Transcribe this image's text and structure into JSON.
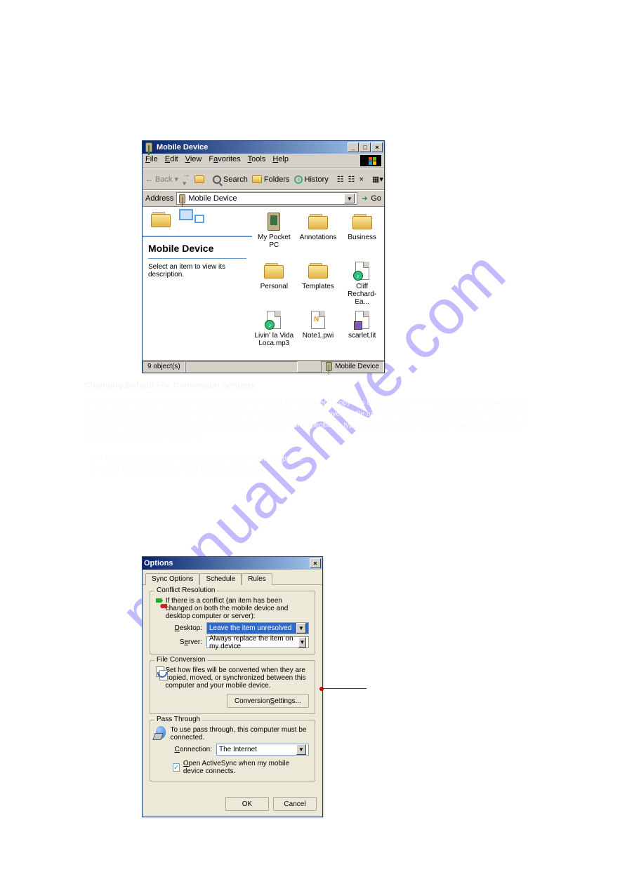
{
  "watermark": "manualshive.com",
  "explorer": {
    "title": "Mobile Device",
    "menus": [
      {
        "u": "F",
        "r": "ile"
      },
      {
        "u": "E",
        "r": "dit"
      },
      {
        "u": "V",
        "r": "iew"
      },
      {
        "l": "F",
        "u": "a",
        "r": "vorites"
      },
      {
        "u": "T",
        "r": "ools"
      },
      {
        "u": "H",
        "r": "elp"
      }
    ],
    "toolbar": {
      "back": "Back",
      "search": "Search",
      "folders": "Folders",
      "history": "History"
    },
    "address_label": "Address",
    "address_value": "Mobile Device",
    "go": "Go",
    "side": {
      "heading": "Mobile Device",
      "desc": "Select an item to view its description."
    },
    "items": [
      "My Pocket PC",
      "Annotations",
      "Business",
      "Personal",
      "Templates",
      "Cliff Rechard-Ea...",
      "Livin' la Vida Loca.mp3",
      "Note1.pwi",
      "scarlet.lit"
    ],
    "status": {
      "left": "9 object(s)",
      "right": "Mobile Device"
    }
  },
  "midtext": {
    "heading": "Changing Default File Conversion Settings",
    "p1": "When you use ActiveSync to synchronize files or use the Mobile Device folder to copy files between your HP iPAQ and desktop PC, ActiveSync may need to convert the file before it can be used. ActiveSync automatically converts a file having a file type or extensions that is registered for conversion. You can change conversion options for all file types or for a specific file type. On your desktop PC, you can change the default file conversion settings using ActiveSync.",
    "steps": [
      "In Microsoft ActiveSync on your desktop PC, click Tools > Options.",
      "Tap the Rules tab, and then click Conversion Settings."
    ]
  },
  "options": {
    "title": "Options",
    "tabs": [
      "Sync Options",
      "Schedule",
      "Rules"
    ],
    "groups": {
      "conflict": {
        "label": "Conflict Resolution",
        "desc": "If there is a conflict (an item has been changed on both the mobile device and desktop computer or server):",
        "desktop_u": "D",
        "desktop_r": "esktop:",
        "desktop_value": "Leave the item unresolved",
        "server_l": "S",
        "server_u": "e",
        "server_r": "rver:",
        "server_value": "Always replace the item on my device"
      },
      "fileconv": {
        "label": "File Conversion",
        "desc": "Set how files will be converted when they are copied, moved, or synchronized between this computer and your mobile device.",
        "button_l": "Conversion ",
        "button_u": "S",
        "button_r": "ettings..."
      },
      "pass": {
        "label": "Pass Through",
        "desc": "To use pass through, this computer must be connected.",
        "conn_u": "C",
        "conn_r": "onnection:",
        "conn_value": "The Internet",
        "chk_u": "O",
        "chk_r": "pen ActiveSync when my mobile device connects."
      }
    },
    "ok": "OK",
    "cancel": "Cancel"
  }
}
